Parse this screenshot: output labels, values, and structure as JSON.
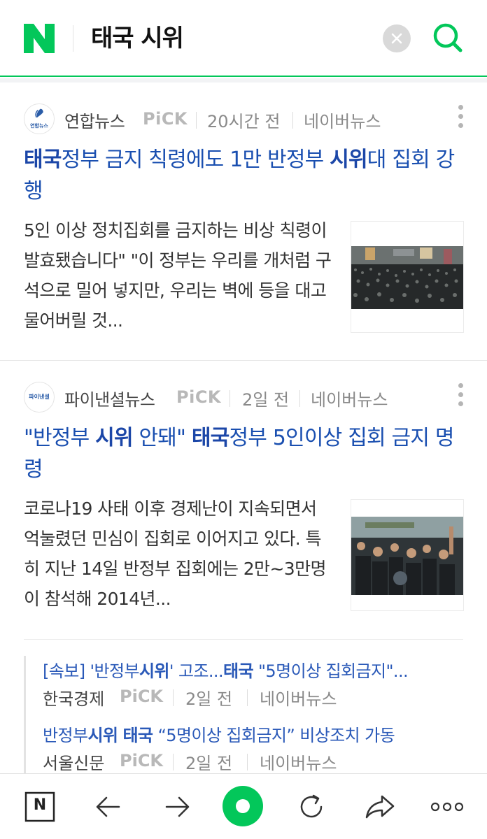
{
  "header": {
    "query": "태국 시위",
    "brand_color": "#03c75a"
  },
  "news": [
    {
      "press": "연합뉴스",
      "press_logo_text": "연합뉴스",
      "pick": "PiCK",
      "time": "20시간 전",
      "source": "네이버뉴스",
      "title_parts": [
        "태국",
        "정부 금지 칙령에도 1만 반정부 ",
        "시위",
        "대 집회 강행"
      ],
      "desc": "5인 이상 정치집회를 금지하는 비상 칙령이 발효됐습니다\" \"이 정부는 우리를 개처럼 구석으로 밀어 넣지만, 우리는 벽에 등을 대고 물어버릴 것...",
      "thumb_icon": "crowd-photo"
    },
    {
      "press": "파이낸셜뉴스",
      "press_logo_text": "파이낸셜",
      "pick": "PiCK",
      "time": "2일 전",
      "source": "네이버뉴스",
      "title_parts": [
        "\"반정부 ",
        "시위",
        " 안돼\" ",
        "태국",
        "정부 5인이상 집회 금지 명령"
      ],
      "desc": "코로나19 사태 이후 경제난이 지속되면서 억눌렸던 민심이 집회로 이어지고 있다. 특히 지난 14일 반정부 집회에는 2만~3만명이 참석해 2014년...",
      "thumb_icon": "protest-photo",
      "related": [
        {
          "title_parts": [
            "[속보] '반정부",
            "시위",
            "' 고조...",
            "태국",
            " \"5명이상 집회금지\"..."
          ],
          "press": "한국경제",
          "pick": "PiCK",
          "time": "2일 전",
          "source": "네이버뉴스"
        },
        {
          "title_parts": [
            "반정부",
            "시위",
            " ",
            "태국",
            " “5명이상 집회금지” 비상조치 가동"
          ],
          "press": "서울신문",
          "pick": "PiCK",
          "time": "2일 전",
          "source": "네이버뉴스"
        }
      ]
    }
  ],
  "bottom_bar": {
    "home_label": "N"
  }
}
